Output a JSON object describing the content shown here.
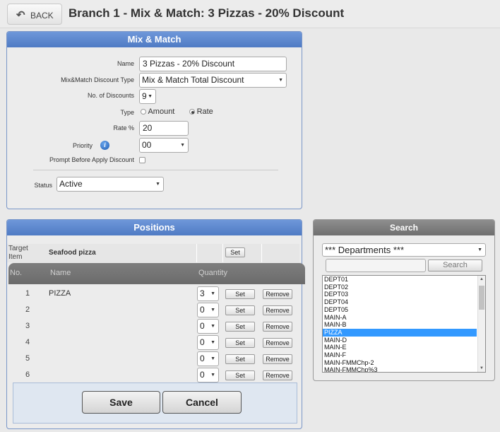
{
  "header": {
    "back_label": "BACK",
    "back_icon": "undo-arrow-icon",
    "title": "Branch 1 - Mix & Match: 3 Pizzas - 20% Discount"
  },
  "mixmatch": {
    "heading": "Mix & Match",
    "name_label": "Name",
    "name_value": "3 Pizzas - 20% Discount",
    "discount_type_label": "Mix&Match Discount Type",
    "discount_type_value": "Mix & Match Total Discount",
    "num_discounts_label": "No. of Discounts",
    "num_discounts_value": "9",
    "type_label": "Type",
    "type_options": [
      "Amount",
      "Rate"
    ],
    "type_selected": "Rate",
    "rate_label": "Rate %",
    "rate_value": "20",
    "priority_label": "Priority",
    "priority_value": "00",
    "prompt_label": "Prompt Before Apply Discount",
    "prompt_checked": false,
    "status_label": "Status",
    "status_value": "Active"
  },
  "positions": {
    "heading": "Positions",
    "target_label_line1": "Target",
    "target_label_line2": "Item",
    "target_value": "Seafood pizza",
    "set_label": "Set",
    "remove_label": "Remove",
    "col_no": "No.",
    "col_name": "Name",
    "col_quantity": "Quantity",
    "rows": [
      {
        "no": "1",
        "name": "PIZZA",
        "qty": "3"
      },
      {
        "no": "2",
        "name": "",
        "qty": "0"
      },
      {
        "no": "3",
        "name": "",
        "qty": "0"
      },
      {
        "no": "4",
        "name": "",
        "qty": "0"
      },
      {
        "no": "5",
        "name": "",
        "qty": "0"
      },
      {
        "no": "6",
        "name": "",
        "qty": "0"
      }
    ],
    "save_label": "Save",
    "cancel_label": "Cancel"
  },
  "search": {
    "heading": "Search",
    "category_value": "*** Departments ***",
    "search_input_value": "",
    "search_button_label": "Search",
    "items": [
      "DEPT01",
      "DEPT02",
      "DEPT03",
      "DEPT04",
      "DEPT05",
      "MAIN-A",
      "MAIN-B",
      "PIZZA",
      "MAIN-D",
      "MAIN-E",
      "MAIN-F",
      "MAIN-FMMChp-2",
      "MAIN-FMMChp%3"
    ],
    "selected_item": "PIZZA"
  },
  "colors": {
    "panel_header": "#5b86cc",
    "search_header": "#7f7f7f",
    "selection": "#3399ff"
  }
}
